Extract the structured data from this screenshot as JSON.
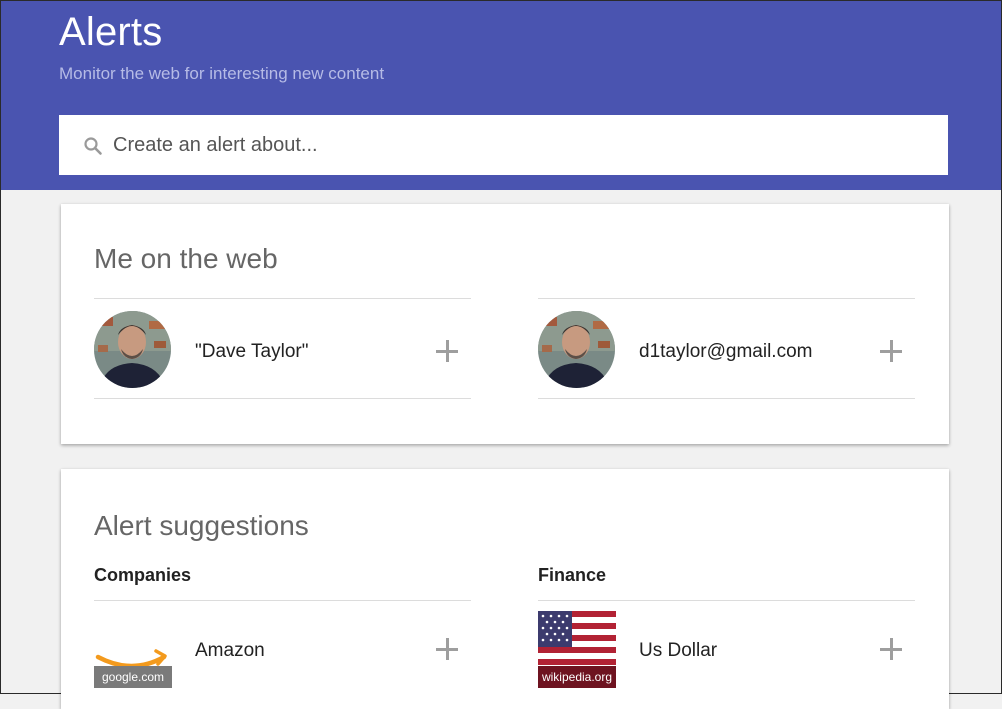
{
  "header": {
    "title": "Alerts",
    "subtitle": "Monitor the web for interesting new content",
    "background_color": "#4a54b0"
  },
  "search": {
    "placeholder": "Create an alert about...",
    "value": "",
    "icon": "search-icon"
  },
  "me_on_the_web": {
    "title": "Me on the web",
    "items": [
      {
        "label": "\"Dave Taylor\"",
        "icon": "avatar",
        "action": "add-icon"
      },
      {
        "label": "d1taylor@gmail.com",
        "icon": "avatar",
        "action": "add-icon"
      }
    ]
  },
  "suggestions": {
    "title": "Alert suggestions",
    "sections": [
      {
        "label": "Companies",
        "items": [
          {
            "label": "Amazon",
            "source": "google.com",
            "icon": "amazon-logo",
            "action": "add-icon"
          }
        ]
      },
      {
        "label": "Finance",
        "items": [
          {
            "label": "Us Dollar",
            "source": "wikipedia.org",
            "icon": "us-flag",
            "action": "add-icon"
          }
        ]
      }
    ]
  }
}
